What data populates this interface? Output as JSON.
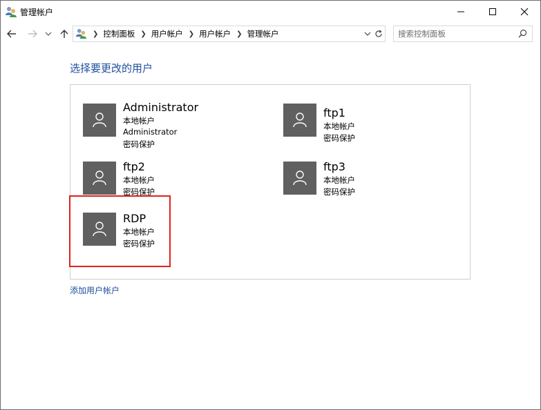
{
  "window": {
    "title": "管理帐户"
  },
  "address_bar": {
    "breadcrumbs": [
      "控制面板",
      "用户帐户",
      "用户帐户",
      "管理帐户"
    ]
  },
  "search": {
    "placeholder": "搜索控制面板"
  },
  "main": {
    "heading": "选择要更改的用户",
    "accounts": [
      {
        "name": "Administrator",
        "lines": [
          "本地帐户",
          "Administrator",
          "密码保护"
        ]
      },
      {
        "name": "ftp1",
        "lines": [
          "本地帐户",
          "密码保护"
        ]
      },
      {
        "name": "ftp2",
        "lines": [
          "本地帐户",
          "密码保护"
        ]
      },
      {
        "name": "ftp3",
        "lines": [
          "本地帐户",
          "密码保护"
        ]
      },
      {
        "name": "RDP",
        "lines": [
          "本地帐户",
          "密码保护"
        ]
      }
    ],
    "add_account_link": "添加用户帐户"
  },
  "colors": {
    "link": "#1e4e9e",
    "avatar_bg": "#606060",
    "highlight_border": "#e0201b"
  }
}
